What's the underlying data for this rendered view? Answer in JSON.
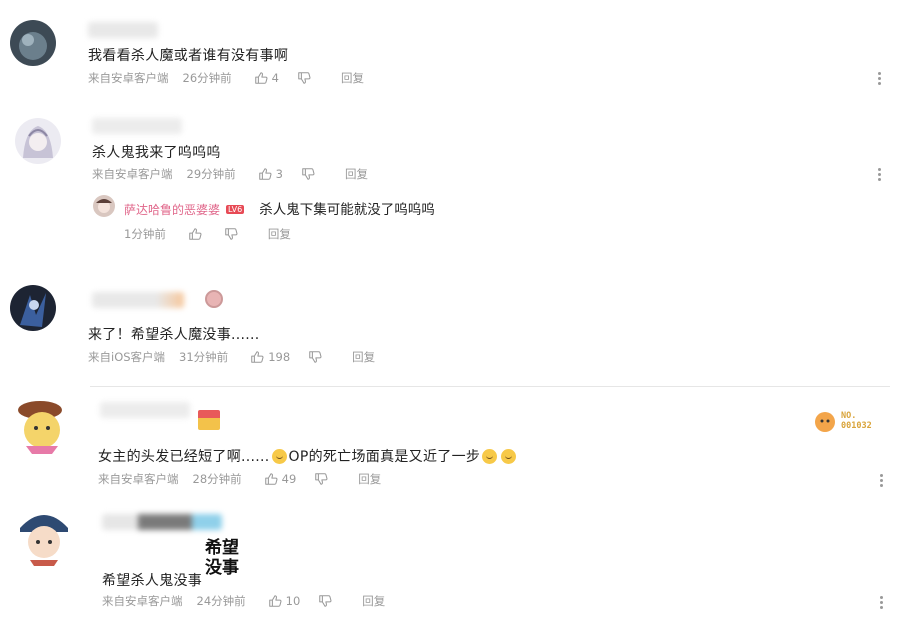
{
  "comments": [
    {
      "text": "我看看杀人魔或者谁有没有事啊",
      "source": "来自安卓客户端",
      "time": "26分钟前",
      "likes": "4",
      "reply_label": "回复"
    },
    {
      "text": "杀人鬼我来了呜呜呜",
      "source": "来自安卓客户端",
      "time": "29分钟前",
      "likes": "3",
      "reply_label": "回复",
      "sub_reply": {
        "username": "萨达哈鲁的恶婆婆",
        "level": "LV6",
        "text": "杀人鬼下集可能就没了呜呜呜",
        "time": "1分钟前",
        "reply_label": "回复"
      }
    },
    {
      "text": "来了！希望杀人魔没事......",
      "source": "来自iOS客户端",
      "time": "31分钟前",
      "likes": "198",
      "reply_label": "回复"
    },
    {
      "text_part1": "女主的头发已经短了啊......",
      "text_part2": "OP的死亡场面真是又近了一步",
      "badge": "NO.\n001032",
      "source": "来自安卓客户端",
      "time": "28分钟前",
      "likes": "49",
      "reply_label": "回复"
    },
    {
      "text": "希望杀人鬼没事",
      "sticker_line1": "希望",
      "sticker_line2": "没事",
      "source": "来自安卓客户端",
      "time": "24分钟前",
      "likes": "10",
      "reply_label": "回复"
    }
  ],
  "icons": {
    "like": "thumbs-up-icon",
    "dislike": "thumbs-down-icon",
    "more": "more-vertical-icon"
  },
  "colors": {
    "meta_gray": "#999999",
    "reply_name_pink": "#e0668a",
    "level_badge_red": "#e74a55"
  }
}
